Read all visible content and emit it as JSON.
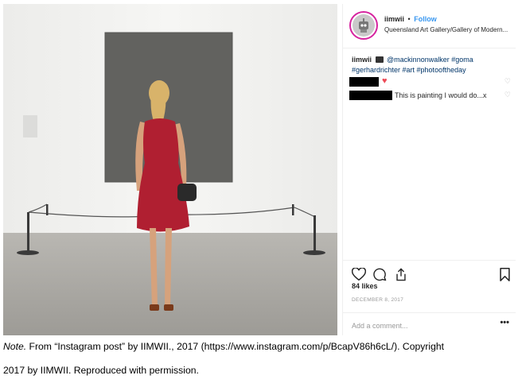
{
  "post": {
    "username": "iimwii",
    "separator": "•",
    "follow_label": "Follow",
    "location": "Queensland Art Gallery/Gallery of Modern...",
    "caption_user": "iimwii",
    "caption_mention": "@mackinnonwalker #goma",
    "caption_hashtags": "#gerhardrichter #art #photooftheday",
    "comments": [
      {
        "text": "",
        "heart": "♥"
      },
      {
        "text": "This is painting I would do...x"
      }
    ],
    "comment_like_icon": "♡",
    "likes": "84 likes",
    "date": "DECEMBER 8, 2017",
    "add_comment_placeholder": "Add a comment...",
    "more_label": "•••"
  },
  "icons": {
    "avatar": "avatar-robot-icon",
    "like": "heart-outline-icon",
    "comment": "comment-bubble-icon",
    "share": "share-upload-icon",
    "save": "bookmark-icon",
    "camera": "camera-emoji-icon"
  },
  "colors": {
    "follow": "#3897f0",
    "hashtag": "#003569",
    "heart": "#ed4956",
    "avatar_ring": "#d6249f"
  },
  "figure_note": {
    "label": "Note.",
    "text_line1": " From “Instagram post” by IIMWII., 2017 (https://www.instagram.com/p/BcapV86h6cL/). Copyright",
    "text_line2": "2017 by IIMWII. Reproduced with permission."
  }
}
